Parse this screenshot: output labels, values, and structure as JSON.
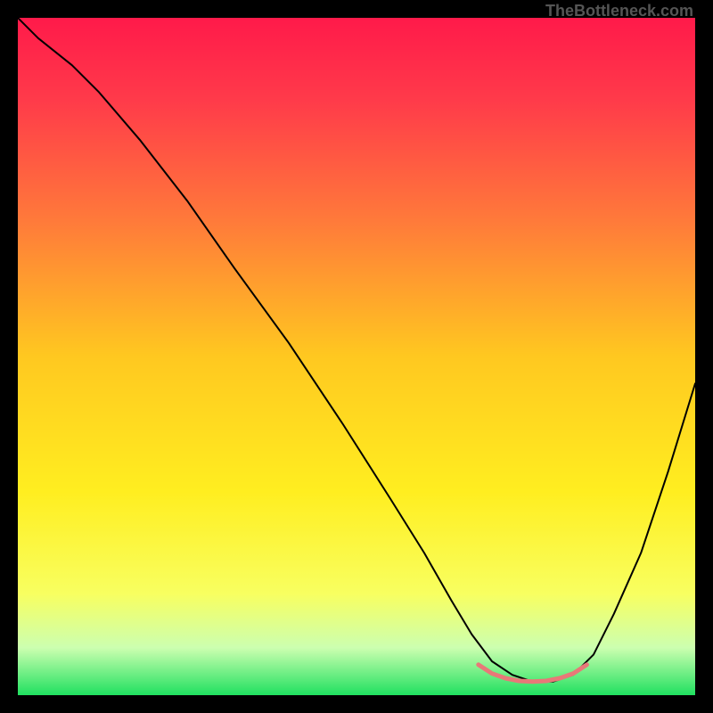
{
  "watermark": "TheBottleneck.com",
  "chart_data": {
    "type": "line",
    "title": "",
    "xlabel": "",
    "ylabel": "",
    "xlim": [
      0,
      100
    ],
    "ylim": [
      0,
      100
    ],
    "background_gradient": {
      "stops": [
        {
          "offset": 0,
          "color": "#ff1a4a"
        },
        {
          "offset": 0.12,
          "color": "#ff3a4a"
        },
        {
          "offset": 0.3,
          "color": "#ff7a3a"
        },
        {
          "offset": 0.5,
          "color": "#ffc820"
        },
        {
          "offset": 0.7,
          "color": "#ffee20"
        },
        {
          "offset": 0.85,
          "color": "#f8ff60"
        },
        {
          "offset": 0.93,
          "color": "#ccffb0"
        },
        {
          "offset": 1.0,
          "color": "#20e060"
        }
      ]
    },
    "series": [
      {
        "name": "bottleneck-curve",
        "color": "#000000",
        "width": 2,
        "x": [
          0,
          3,
          8,
          12,
          18,
          25,
          32,
          40,
          48,
          55,
          60,
          64,
          67,
          70,
          73,
          76,
          79,
          82,
          85,
          88,
          92,
          96,
          100
        ],
        "values": [
          100,
          97,
          93,
          89,
          82,
          73,
          63,
          52,
          40,
          29,
          21,
          14,
          9,
          5,
          3,
          2,
          2,
          3,
          6,
          12,
          21,
          33,
          46
        ]
      },
      {
        "name": "optimal-range-marker",
        "color": "#e87878",
        "width": 5,
        "x": [
          68,
          70,
          72,
          74,
          76,
          78,
          80,
          82,
          84
        ],
        "values": [
          4.5,
          3.2,
          2.5,
          2.1,
          2.0,
          2.1,
          2.5,
          3.2,
          4.5
        ]
      }
    ]
  }
}
